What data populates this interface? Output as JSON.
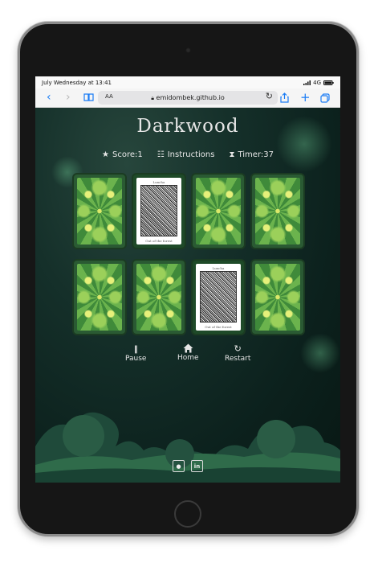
{
  "status_bar": {
    "datetime": "July Wednesday at 13:41",
    "network": "4G"
  },
  "browser": {
    "text_size_label": "AA",
    "url": "emidombek.github.io"
  },
  "game": {
    "title": "Darkwood",
    "hud": {
      "score": "Score:1",
      "instructions": "Instructions",
      "timer": "Timer:37"
    },
    "cards": [
      {
        "state": "back"
      },
      {
        "state": "face",
        "label": "Luxcha",
        "caption": "Out of the forest"
      },
      {
        "state": "back"
      },
      {
        "state": "back"
      },
      {
        "state": "back"
      },
      {
        "state": "back"
      },
      {
        "state": "face",
        "label": "Luxcha",
        "caption": "Out of the forest"
      },
      {
        "state": "back"
      }
    ],
    "controls": {
      "pause": "Pause",
      "home": "Home",
      "restart": "Restart"
    },
    "social": [
      "github-icon",
      "linkedin-icon"
    ]
  },
  "colors": {
    "accent": "#1a7cf5",
    "card_frame": "#2a5a33",
    "background": "#0c1f1b"
  }
}
